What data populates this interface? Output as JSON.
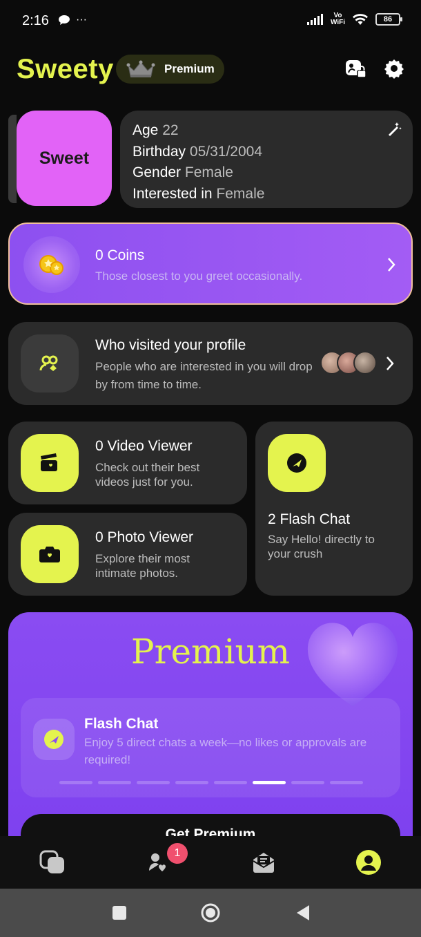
{
  "status_bar": {
    "time": "2:16",
    "more": "···",
    "volte_top": "Vo",
    "volte_bottom": "WiFi",
    "battery": "86"
  },
  "header": {
    "title": "Sweety",
    "premium_label": "Premium"
  },
  "profile": {
    "avatar_text": "Sweet",
    "age_label": "Age",
    "age_value": "22",
    "birthday_label": "Birthday",
    "birthday_value": "05/31/2004",
    "gender_label": "Gender",
    "gender_value": "Female",
    "interested_label": "Interested in",
    "interested_value": "Female"
  },
  "coins": {
    "title": "0 Coins",
    "subtitle": "Those closest to you greet occasionally."
  },
  "visitors": {
    "title": "Who visited your profile",
    "subtitle": "People who are interested in you will drop by from time to time."
  },
  "video_viewer": {
    "title": "0 Video Viewer",
    "subtitle": "Check out their best videos just for you."
  },
  "photo_viewer": {
    "title": "0 Photo Viewer",
    "subtitle": "Explore their most intimate photos."
  },
  "flash_chat_tile": {
    "title": "2 Flash Chat",
    "subtitle": "Say Hello! directly to your crush"
  },
  "premium_banner": {
    "heading": "Premium",
    "feature_title": "Flash Chat",
    "feature_subtitle": "Enjoy 5 direct chats a week—no likes or approvals are required!",
    "carousel_active_index": 6,
    "carousel_count": 8,
    "cta_label": "Get Premium"
  },
  "bottom_nav": {
    "likes_badge": "1",
    "active_tab": "profile"
  },
  "colors": {
    "accent_lime": "#e4f34e",
    "accent_purple": "#8d50f0",
    "card_bg": "#2b2b2b",
    "badge_red": "#f0506e"
  }
}
